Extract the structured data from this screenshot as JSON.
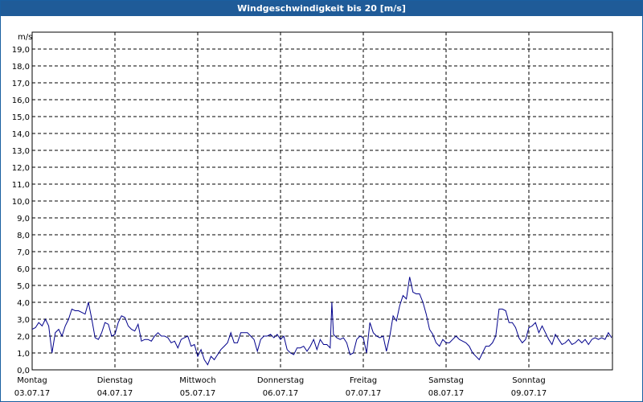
{
  "title": "Windgeschwindigkeit bis 20 [m/s]",
  "chart_data": {
    "type": "line",
    "title": "Windgeschwindigkeit bis 20 [m/s]",
    "unit_label": "m/s",
    "ylim": [
      0,
      20
    ],
    "yticks": [
      "0,0",
      "1,0",
      "2,0",
      "3,0",
      "4,0",
      "5,0",
      "6,0",
      "7,0",
      "8,0",
      "9,0",
      "10,0",
      "11,0",
      "12,0",
      "13,0",
      "14,0",
      "15,0",
      "16,0",
      "17,0",
      "18,0",
      "19,0"
    ],
    "x_days": [
      {
        "day": "Montag",
        "date": "03.07.17"
      },
      {
        "day": "Dienstag",
        "date": "04.07.17"
      },
      {
        "day": "Mittwoch",
        "date": "05.07.17"
      },
      {
        "day": "Donnerstag",
        "date": "06.07.17"
      },
      {
        "day": "Freitag",
        "date": "07.07.17"
      },
      {
        "day": "Samstag",
        "date": "08.07.17"
      },
      {
        "day": "Sonntag",
        "date": "09.07.17"
      }
    ],
    "grid": true,
    "line_color": "#00008b",
    "series": [
      {
        "x": [
          0,
          0.04,
          0.08,
          0.12,
          0.16,
          0.2,
          0.24,
          0.28,
          0.32,
          0.36,
          0.4,
          0.44,
          0.48,
          0.52,
          0.56,
          0.6,
          0.64,
          0.68,
          0.72,
          0.76,
          0.8,
          0.84,
          0.88,
          0.92,
          0.96,
          1,
          1.04,
          1.08,
          1.12,
          1.16,
          1.2,
          1.24,
          1.28,
          1.32,
          1.36,
          1.4,
          1.44,
          1.48,
          1.52,
          1.56,
          1.6,
          1.64,
          1.68,
          1.72,
          1.76,
          1.8,
          1.84,
          1.88,
          1.92,
          1.96,
          2,
          2.04,
          2.08,
          2.12,
          2.16,
          2.2,
          2.24,
          2.28,
          2.32,
          2.36,
          2.4,
          2.44,
          2.48,
          2.52,
          2.56,
          2.6,
          2.64,
          2.68,
          2.72,
          2.76,
          2.8,
          2.84,
          2.88,
          2.92,
          2.96,
          3,
          3.04,
          3.08,
          3.12,
          3.16,
          3.2,
          3.24,
          3.28,
          3.32,
          3.36,
          3.4,
          3.44,
          3.48,
          3.52,
          3.56,
          3.6,
          3.62,
          3.64,
          3.68,
          3.72,
          3.76,
          3.8,
          3.84,
          3.88,
          3.92,
          3.96,
          4,
          4.04,
          4.08,
          4.12,
          4.16,
          4.2,
          4.24,
          4.28,
          4.32,
          4.36,
          4.4,
          4.44,
          4.48,
          4.52,
          4.56,
          4.6,
          4.64,
          4.68,
          4.72,
          4.76,
          4.8,
          4.84,
          4.88,
          4.92,
          4.96,
          5,
          5.04,
          5.08,
          5.12,
          5.16,
          5.2,
          5.24,
          5.28,
          5.32,
          5.36,
          5.4,
          5.44,
          5.48,
          5.52,
          5.56,
          5.6,
          5.64,
          5.68,
          5.72,
          5.76,
          5.8,
          5.84,
          5.88,
          5.92,
          5.96,
          6,
          6.04,
          6.08,
          6.12,
          6.16,
          6.2,
          6.24,
          6.28,
          6.32,
          6.36,
          6.4,
          6.44,
          6.48,
          6.52,
          6.56,
          6.6,
          6.64,
          6.68,
          6.72,
          6.76,
          6.8,
          6.84,
          6.88,
          6.92,
          6.96,
          7
        ],
        "y": [
          2.4,
          2.5,
          2.8,
          2.6,
          3.0,
          2.6,
          1.0,
          2.2,
          2.4,
          2.0,
          2.6,
          3.0,
          3.6,
          3.5,
          3.5,
          3.4,
          3.3,
          4.0,
          3.0,
          1.9,
          1.8,
          2.2,
          2.8,
          2.7,
          2.0,
          2.1,
          2.8,
          3.2,
          3.1,
          2.6,
          2.4,
          2.3,
          2.7,
          1.7,
          1.8,
          1.8,
          1.7,
          2.0,
          2.2,
          2.0,
          2.0,
          1.9,
          1.6,
          1.7,
          1.3,
          1.8,
          1.9,
          2.0,
          1.4,
          1.5,
          0.8,
          1.2,
          0.6,
          0.3,
          0.8,
          0.6,
          0.9,
          1.2,
          1.4,
          1.6,
          2.2,
          1.6,
          1.6,
          2.2,
          2.2,
          2.2,
          2.0,
          1.8,
          1.1,
          1.8,
          2.0,
          2.0,
          2.1,
          1.9,
          2.1,
          1.8,
          2.0,
          1.2,
          1.0,
          0.9,
          1.3,
          1.3,
          1.4,
          1.1,
          1.4,
          1.8,
          1.2,
          1.8,
          1.5,
          1.5,
          1.3,
          4.0,
          2.1,
          1.9,
          1.8,
          1.9,
          1.6,
          0.9,
          1.0,
          1.8,
          2.0,
          1.9,
          1.0,
          2.8,
          2.2,
          2.0,
          1.9,
          2.0,
          1.1,
          2.0,
          3.2,
          2.9,
          3.8,
          4.4,
          4.2,
          5.5,
          4.6,
          4.5,
          4.5,
          4.0,
          3.3,
          2.4,
          2.1,
          1.6,
          1.4,
          1.8,
          1.6,
          1.6,
          1.8,
          2.0,
          1.8,
          1.7,
          1.6,
          1.4,
          1.0,
          0.8,
          0.6,
          1.0,
          1.4,
          1.4,
          1.6,
          2.0,
          3.6,
          3.6,
          3.5,
          2.8,
          2.8,
          2.5,
          1.9,
          1.6,
          1.8,
          2.5,
          2.6,
          2.8,
          2.2,
          2.6,
          2.2,
          1.8,
          1.5,
          2.1,
          1.8,
          1.5,
          1.6,
          1.8,
          1.5,
          1.6,
          1.8,
          1.6,
          1.8,
          1.5,
          1.8,
          1.9,
          1.8,
          1.9,
          1.8,
          2.2,
          1.9
        ]
      }
    ]
  }
}
